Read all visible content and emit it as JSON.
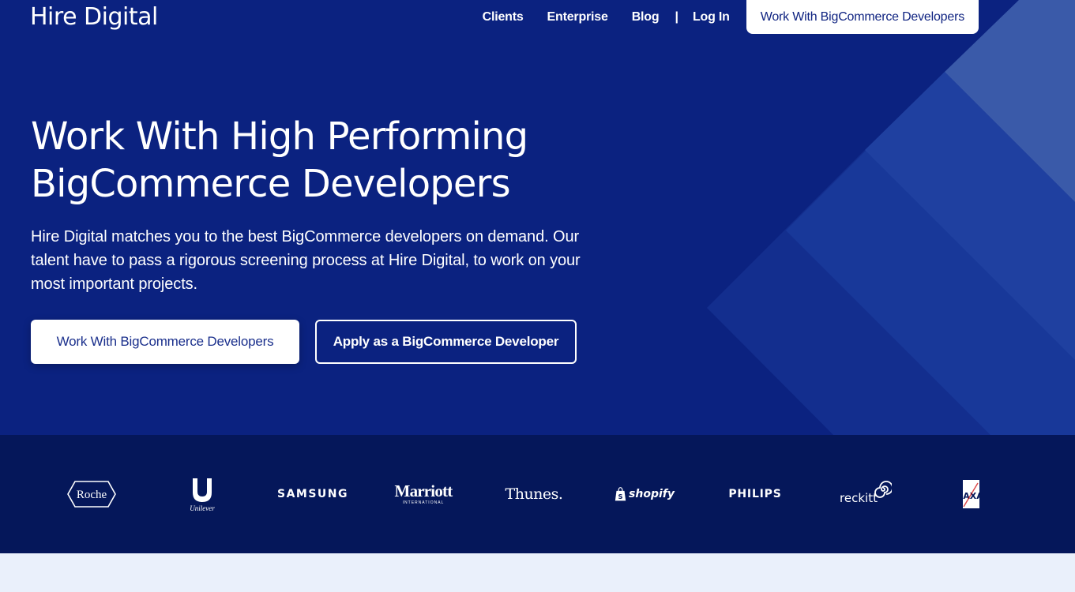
{
  "brand": {
    "logo": "Hire Digital"
  },
  "nav": {
    "links": [
      "Clients",
      "Enterprise",
      "Blog"
    ],
    "separator": "|",
    "login": "Log In",
    "cta": "Work With BigCommerce Developers"
  },
  "hero": {
    "headline_line1": "Work With High Performing",
    "headline_line2": "BigCommerce Developers",
    "subtext": "Hire Digital matches you to the best BigCommerce developers on demand. Our talent have to pass a rigorous screening process at Hire Digital, to work on your most important projects.",
    "primary_button": "Work With BigCommerce Developers",
    "secondary_button": "Apply as a BigCommerce Developer"
  },
  "clients": {
    "logos": [
      "Roche",
      "Unilever",
      "SAMSUNG",
      "Marriott",
      "Thunes.",
      "shopify",
      "PHILIPS",
      "reckitt",
      "AXA"
    ],
    "marriott_sub": "INTERNATIONAL"
  },
  "colors": {
    "hero_bg": "#0b2280",
    "clients_bg": "#05175a",
    "lower_bg": "#eaf0fb",
    "button_text": "#1a2f8c"
  }
}
